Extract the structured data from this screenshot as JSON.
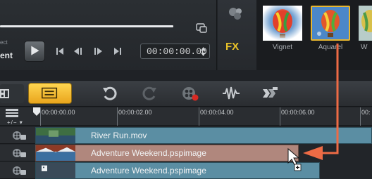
{
  "preview": {
    "project_label_top": "ect",
    "project_label": "ent",
    "timecode": "00:00:00.00"
  },
  "fx": {
    "label": "FX"
  },
  "effects": [
    {
      "label": "Vignet"
    },
    {
      "label": "Aquarel"
    },
    {
      "label": "W"
    }
  ],
  "ruler": {
    "track_toggle": "+/− ▾",
    "ticks": [
      "00:00:00.00",
      "00:00:02.00",
      "00:00:04.00",
      "00:00:06.00",
      "00:"
    ]
  },
  "tracks": [
    {
      "clip": "River Run.mov"
    },
    {
      "clip": "Adventure Weekend.pspimage"
    },
    {
      "clip": "Adventure Weekend.pspimage"
    }
  ],
  "colors": {
    "accent_yellow": "#e9b22a",
    "drag_arrow": "#ee6b45",
    "video_clip": "#5b8ea3",
    "overlay_clip": "#b0877d"
  }
}
